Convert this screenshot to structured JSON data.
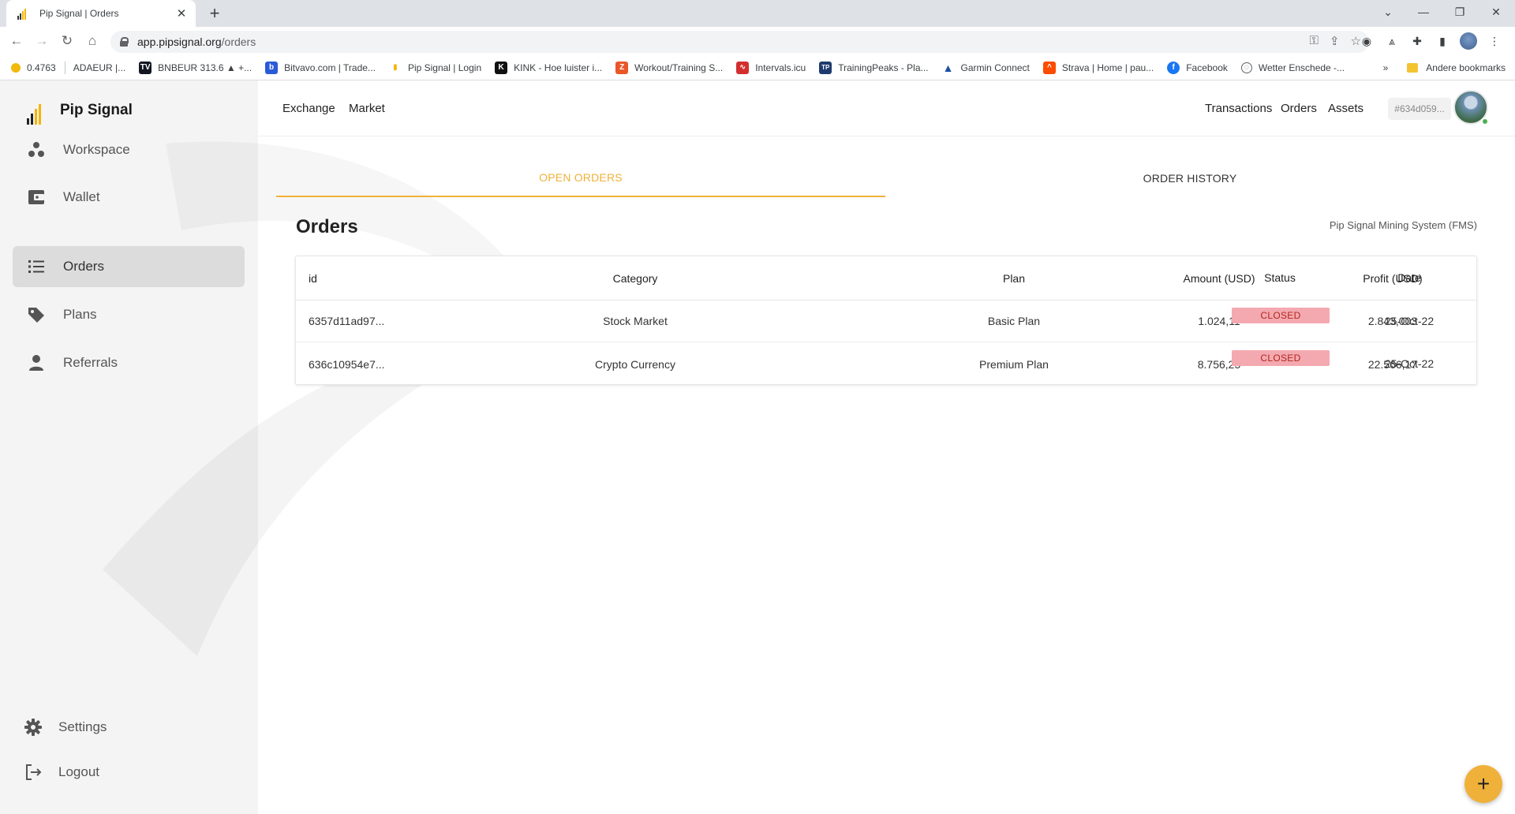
{
  "browser": {
    "tab_title": "Pip Signal | Orders",
    "url_host": "app.pipsignal.org",
    "url_path": "/orders",
    "bookmarks": [
      {
        "label": "0.4763",
        "icon": "binance-icon",
        "color": "#f0b90b"
      },
      {
        "label": "ADAEUR |...",
        "icon": "",
        "color": ""
      },
      {
        "label": "BNBEUR 313.6 ▲ +...",
        "icon": "tradingview-icon",
        "color": "#131722"
      },
      {
        "label": "Bitvavo.com | Trade...",
        "icon": "bitvavo-icon",
        "color": "#2a5bd7"
      },
      {
        "label": "Pip Signal | Login",
        "icon": "pipsignal-icon",
        "color": "#ffffff"
      },
      {
        "label": "KINK - Hoe luister i...",
        "icon": "kink-icon",
        "color": "#111111"
      },
      {
        "label": "Workout/Training S...",
        "icon": "workout-icon",
        "color": "#e8562a"
      },
      {
        "label": "Intervals.icu",
        "icon": "intervals-icon",
        "color": "#d32f2f"
      },
      {
        "label": "TrainingPeaks - Pla...",
        "icon": "trainingpeaks-icon",
        "color": "#1e3a6e"
      },
      {
        "label": "Garmin Connect",
        "icon": "garmin-icon",
        "color": "#1a4fa0"
      },
      {
        "label": "Strava | Home | pau...",
        "icon": "strava-icon",
        "color": "#fc4c02"
      },
      {
        "label": "Facebook",
        "icon": "facebook-icon",
        "color": "#1877f2"
      },
      {
        "label": "Wetter Enschede -...",
        "icon": "globe-icon",
        "color": "#5f6368"
      }
    ],
    "more_bookmarks": "»",
    "other_bookmarks": "Andere bookmarks"
  },
  "app": {
    "brand": "Pip Signal",
    "sidebar": [
      {
        "label": "Workspace",
        "icon": "workspace-icon",
        "active": false
      },
      {
        "label": "Wallet",
        "icon": "wallet-icon",
        "active": false
      },
      {
        "label": "Orders",
        "icon": "list-icon",
        "active": true
      },
      {
        "label": "Plans",
        "icon": "tag-icon",
        "active": false
      },
      {
        "label": "Referrals",
        "icon": "user-icon",
        "active": false
      }
    ],
    "settings_label": "Settings",
    "logout_label": "Logout",
    "topnav": {
      "left": [
        "Exchange",
        "Market"
      ],
      "right": [
        "Transactions",
        "Orders",
        "Assets"
      ],
      "account_id": "#634d059..."
    },
    "tabs": [
      "OPEN ORDERS",
      "ORDER HISTORY"
    ],
    "page_title": "Orders",
    "subtitle": "Pip Signal Mining System (FMS)",
    "table": {
      "headers": [
        "id",
        "Category",
        "Plan",
        "Amount (USD)",
        "Profit (USD)",
        "Status",
        "Date"
      ],
      "rows": [
        {
          "id": "6357d11ad97...",
          "category": "Stock Market",
          "plan": "Basic Plan",
          "amount": "1.024,11",
          "profit": "2.843,003",
          "status": "CLOSED",
          "date": "25-Oct-22"
        },
        {
          "id": "636c10954e7...",
          "category": "Crypto Currency",
          "plan": "Premium Plan",
          "amount": "8.756,25",
          "profit": "22.566,17",
          "status": "CLOSED",
          "date": "25-Oct-22"
        }
      ]
    },
    "fab_icon": "plus-icon",
    "accent_color": "#f0b13a",
    "status_closed_color": "#f4a9b0"
  }
}
